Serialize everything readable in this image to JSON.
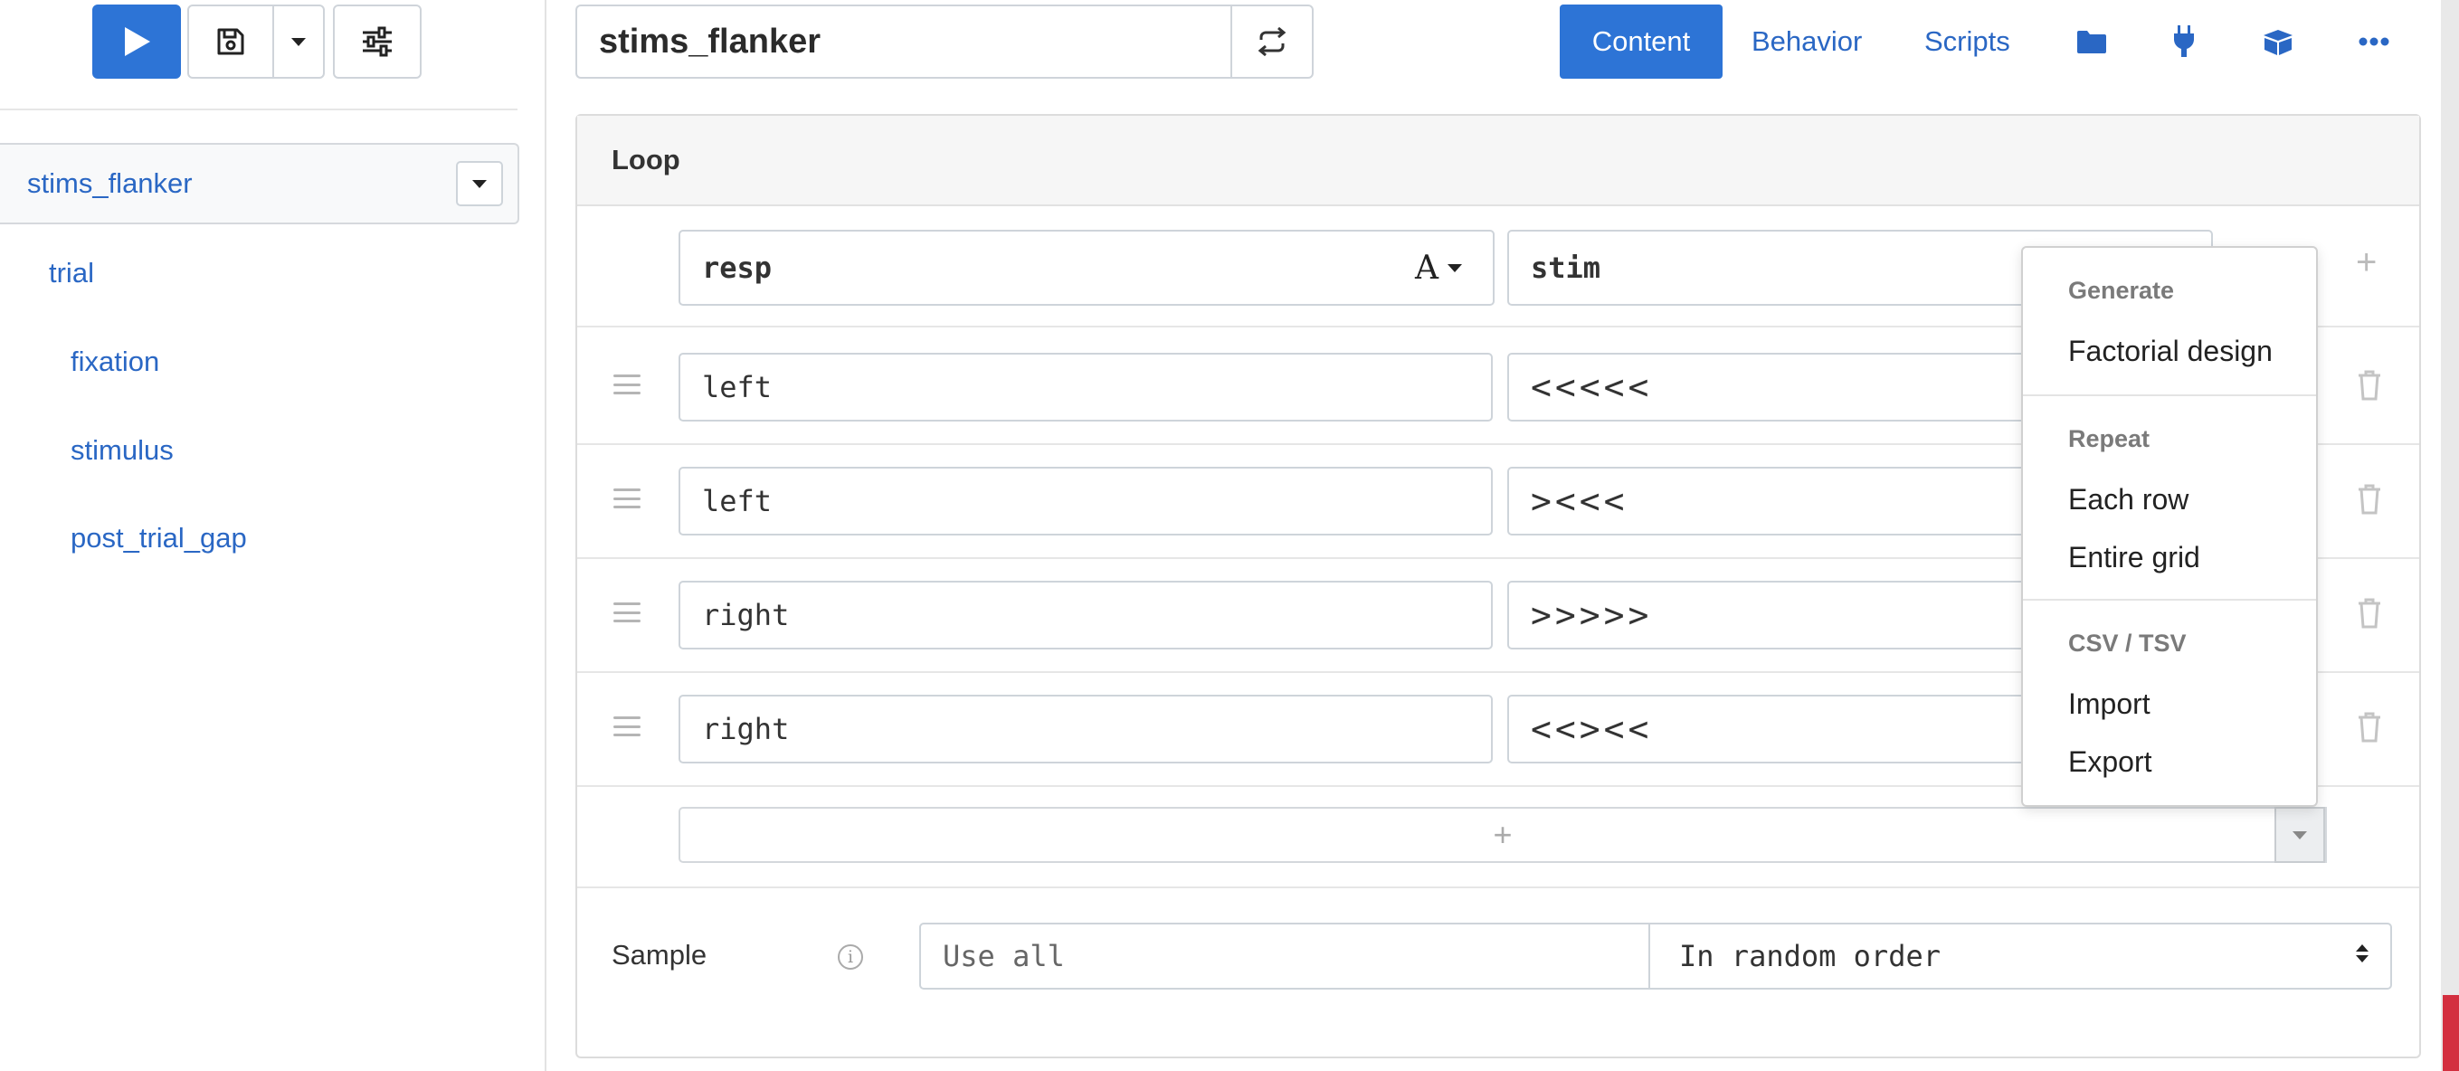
{
  "sidebar": {
    "root": {
      "label": "stims_flanker"
    },
    "items": [
      {
        "label": "trial"
      },
      {
        "label": "fixation"
      },
      {
        "label": "stimulus"
      },
      {
        "label": "post_trial_gap"
      }
    ]
  },
  "header": {
    "title": "stims_flanker",
    "tabs": {
      "content": "Content",
      "behavior": "Behavior",
      "scripts": "Scripts"
    }
  },
  "loop": {
    "heading": "Loop",
    "columns": [
      {
        "name": "resp",
        "type_symbol": "A"
      },
      {
        "name": "stim"
      }
    ],
    "rows": [
      {
        "resp": "left",
        "stim": "<<<<<"
      },
      {
        "resp": "left",
        "stim": "><<<"
      },
      {
        "resp": "right",
        "stim": ">>>>>"
      },
      {
        "resp": "right",
        "stim": "<<><<"
      }
    ],
    "add_symbol": "+"
  },
  "sample": {
    "label": "Sample",
    "info_symbol": "i",
    "mode_placeholder": "Use all",
    "order": "In random order"
  },
  "menu": {
    "generate_heading": "Generate",
    "factorial": "Factorial design",
    "repeat_heading": "Repeat",
    "each_row": "Each row",
    "entire_grid": "Entire grid",
    "csv_heading": "CSV / TSV",
    "import": "Import",
    "export": "Export"
  },
  "colors": {
    "accent": "#2d74d6",
    "link": "#2a67c4",
    "danger_edge": "#d32f3f"
  }
}
